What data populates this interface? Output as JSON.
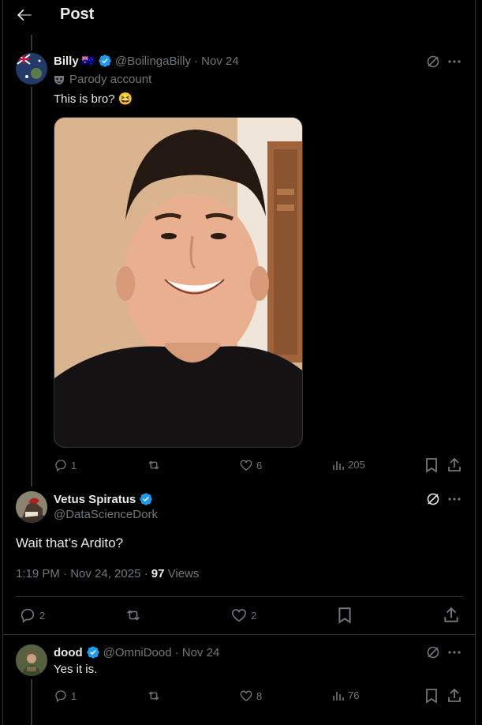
{
  "header": {
    "title": "Post"
  },
  "post1": {
    "name": "Billy",
    "flag": "🇦🇺",
    "handle": "@BoilingaBilly",
    "date": "· Nov 24",
    "parody": "Parody account",
    "text": "This is bro? 😆",
    "stats": {
      "replies": "1",
      "reposts": "",
      "likes": "6",
      "views": "205"
    }
  },
  "post2": {
    "name": "Vetus Spiratus",
    "handle": "@DataScienceDork",
    "text": "Wait that’s Ardito?",
    "time": "1:19 PM · Nov 24, 2025 ·",
    "views_count": "97",
    "views_label": "Views",
    "stats": {
      "replies": "2",
      "reposts": "",
      "likes": "2"
    }
  },
  "post3": {
    "name": "dood",
    "handle": "@OmniDood",
    "date": "· Nov 24",
    "text": "Yes it is.",
    "stats": {
      "replies": "1",
      "reposts": "",
      "likes": "8",
      "views": "76"
    }
  },
  "colors": {
    "verified": "#1d9bf0",
    "text": "#e7e9ea",
    "muted": "#71767b",
    "divider": "#2f3336"
  }
}
